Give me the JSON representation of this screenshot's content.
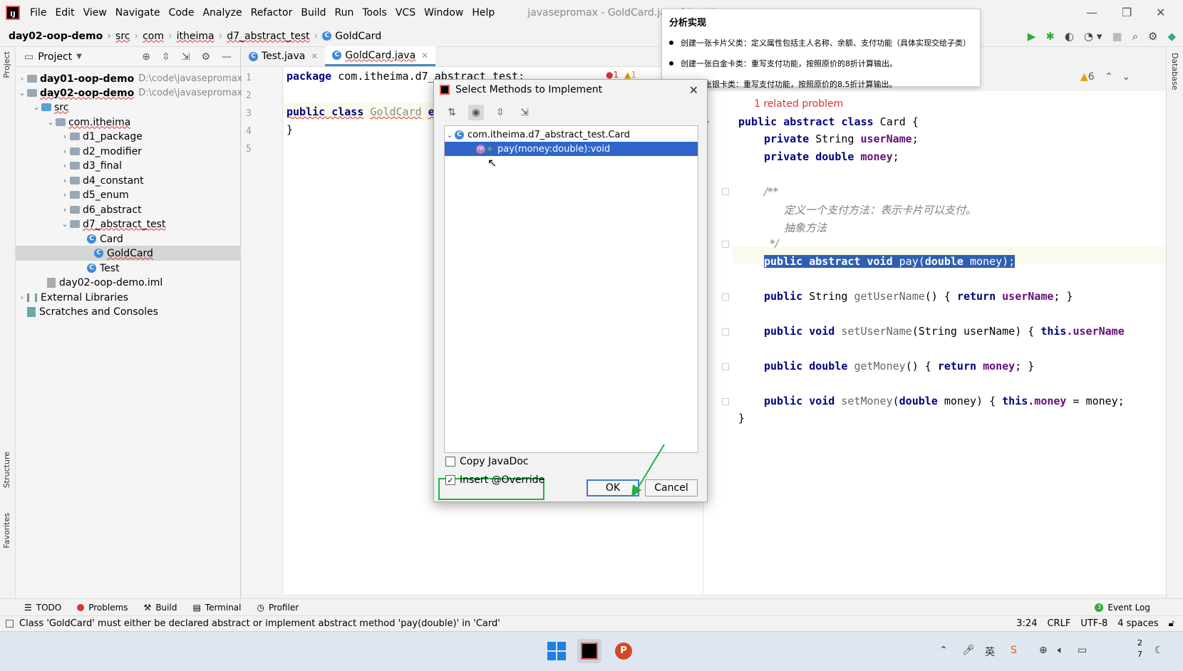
{
  "menu": [
    "File",
    "Edit",
    "View",
    "Navigate",
    "Code",
    "Analyze",
    "Refactor",
    "Build",
    "Run",
    "Tools",
    "VCS",
    "Window",
    "Help"
  ],
  "window_title": "javasepromax - GoldCard.java [day02-oop",
  "breadcrumb": [
    "day02-oop-demo",
    "src",
    "com",
    "itheima",
    "d7_abstract_test",
    "GoldCard"
  ],
  "project_panel": {
    "title": "Project",
    "tree": [
      {
        "label": "day01-oop-demo",
        "path": "D:\\code\\javasepromax\\"
      },
      {
        "label": "day02-oop-demo",
        "path": "D:\\code\\javasepromax\\"
      },
      {
        "label": "src"
      },
      {
        "label": "com.itheima"
      },
      {
        "label": "d1_package"
      },
      {
        "label": "d2_modifier"
      },
      {
        "label": "d3_final"
      },
      {
        "label": "d4_constant"
      },
      {
        "label": "d5_enum"
      },
      {
        "label": "d6_abstract"
      },
      {
        "label": "d7_abstract_test"
      },
      {
        "label": "Card"
      },
      {
        "label": "GoldCard"
      },
      {
        "label": "Test"
      },
      {
        "label": "day02-oop-demo.iml"
      },
      {
        "label": "External Libraries"
      },
      {
        "label": "Scratches and Consoles"
      }
    ]
  },
  "left_strip": {
    "project": "Project",
    "structure": "Structure",
    "favorites": "Favorites"
  },
  "right_strip": {
    "database": "Database"
  },
  "editor_tabs": [
    {
      "label": "Test.java"
    },
    {
      "label": "GoldCard.java",
      "active": true
    }
  ],
  "left_code": {
    "line_numbers": [
      "1",
      "2",
      "3",
      "4",
      "5"
    ],
    "line1_kw": "package",
    "line1_rest": " com.itheima.d7_abstract_test;",
    "line3_kw": "public class",
    "line3_cls": "GoldCard",
    "line3_rest": "ex",
    "line4": "}",
    "error_count": "1",
    "warn_count": "1"
  },
  "right_code": {
    "related_problem": "1 related problem",
    "warn_count": "6",
    "class_decl_kw": "public abstract class",
    "class_decl_rest": " Card {",
    "field1_kw": "private",
    "field1_type": " String ",
    "field1_name": "userName",
    "field2_kw": "private double",
    "field2_name": "money",
    "comment_open": "/**",
    "comment_l1": "定义一个支付方法：表示卡片可以支付。",
    "comment_l2": "抽象方法",
    "comment_close": "*/",
    "abstract_method_kw": "public abstract void",
    "abstract_method_rest": " pay(",
    "abstract_method_param_kw": "double",
    "abstract_method_end": " money);",
    "get_user_kw": "public",
    "get_user_type": " String ",
    "get_user_name": "getUserName",
    "get_user_body_kw": "return",
    "get_user_field": "userName",
    "set_user_kw": "public void",
    "set_user_name": "setUserName",
    "set_user_params": "(String userName) ",
    "set_user_this": "this",
    "set_user_field": ".userName",
    "get_money_kw": "public double",
    "get_money_name": "getMoney",
    "get_money_body_kw": "return",
    "get_money_field": "money",
    "set_money_kw": "public void",
    "set_money_name": "setMoney",
    "set_money_params_kw": "double",
    "set_money_params_rest": " money) ",
    "set_money_this": "this",
    "set_money_field": ".money",
    "set_money_end": " = money;",
    "closing_brace": "}"
  },
  "analysis_popup": {
    "title": "分析实现",
    "items": [
      "创建一张卡片父类：定义属性包括主人名称、余额、支付功能（具体实现交给子类）",
      "创建一张白金卡类：重写支付功能，按照原价的8折计算输出。",
      "创建一张银卡类：重写支付功能，按照原价的8.5折计算输出。"
    ]
  },
  "dialog": {
    "title": "Select Methods to Implement",
    "class_node": "com.itheima.d7_abstract_test.Card",
    "method_node": "pay(money:double):void",
    "copy_javadoc": "Copy JavaDoc",
    "insert_override": "Insert @Override",
    "copy_javadoc_checked": false,
    "insert_override_checked": true,
    "ok": "OK",
    "cancel": "Cancel"
  },
  "bottom_tools": [
    "TODO",
    "Problems",
    "Build",
    "Terminal",
    "Profiler"
  ],
  "event_log": "Event Log",
  "status": {
    "message": "Class 'GoldCard' must either be declared abstract or implement abstract method 'pay(double)' in 'Card'",
    "position": "3:24",
    "line_sep": "CRLF",
    "encoding": "UTF-8",
    "indent": "4 spaces"
  },
  "taskbar": {
    "clock_line1": "2",
    "clock_line2": "7"
  },
  "colors": {
    "accent": "#2f65ca",
    "highlight_box": "#22b043",
    "error": "#dd3333"
  }
}
